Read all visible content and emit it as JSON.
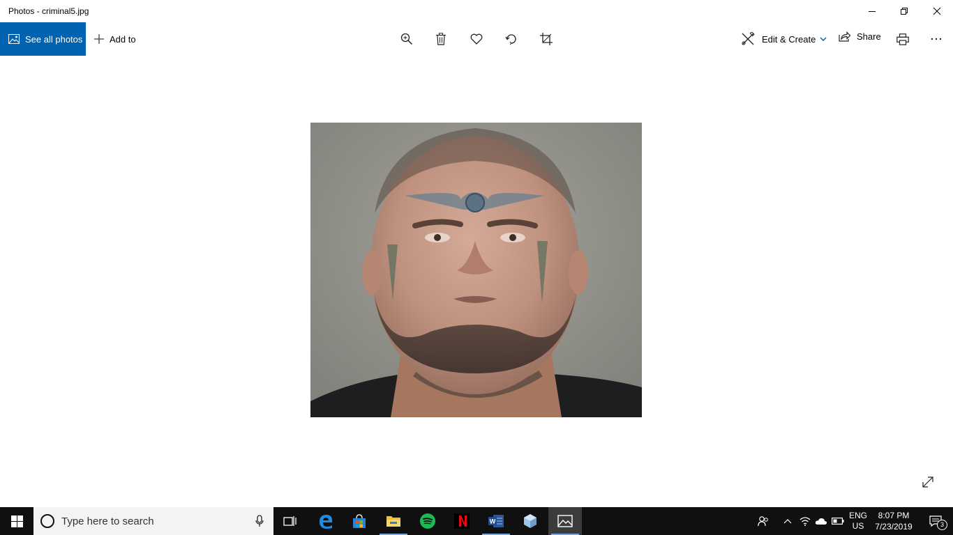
{
  "window": {
    "title": "Photos - criminal5.jpg"
  },
  "toolbar": {
    "see_all_label": "See all photos",
    "add_to_label": "Add to",
    "edit_create_label": "Edit & Create",
    "share_label": "Share",
    "icons": [
      "zoom-icon",
      "delete-icon",
      "favorite-icon",
      "rotate-icon",
      "crop-icon",
      "print-icon",
      "more-icon"
    ]
  },
  "taskbar": {
    "search_placeholder": "Type here to search",
    "apps": [
      "task-view",
      "edge",
      "store",
      "file-explorer",
      "spotify",
      "netflix",
      "word",
      "3d-viewer",
      "photos"
    ],
    "tray": {
      "lang_line1": "ENG",
      "lang_line2": "US",
      "time": "8:07 PM",
      "date": "7/23/2019",
      "notification_count": "3"
    }
  },
  "colors": {
    "accent": "#0063b1",
    "taskbar": "#101010",
    "search_box": "#f3f3f3"
  }
}
